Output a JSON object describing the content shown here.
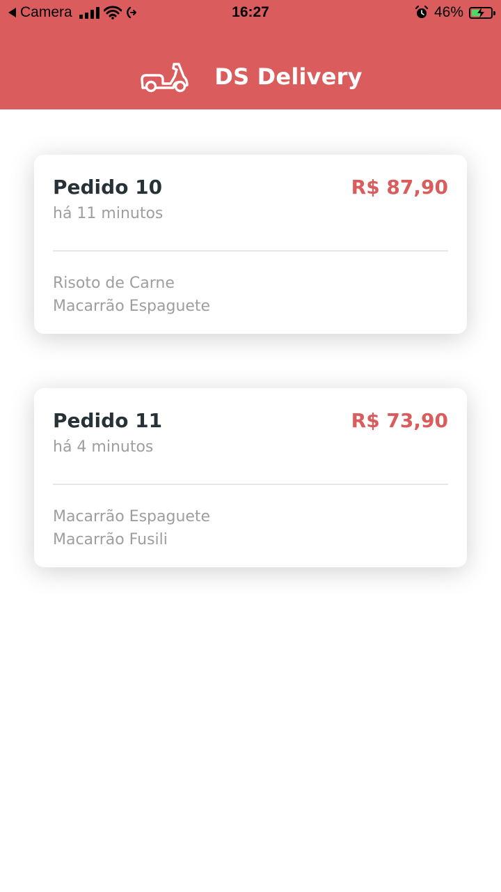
{
  "status_bar": {
    "back_label": "Camera",
    "time": "16:27",
    "battery_percent": "46%",
    "battery_level": 0.46,
    "icons": [
      "back-arrow-icon",
      "cellular-signal-icon",
      "wifi-icon",
      "call-forwarding-icon",
      "alarm-icon",
      "battery-charging-icon"
    ]
  },
  "header": {
    "title": "DS Delivery",
    "logo_icon": "delivery-scooter-icon",
    "background_color": "#DA5C5C"
  },
  "orders": [
    {
      "name": "Pedido 10",
      "time_ago": "há 11 minutos",
      "price": "R$ 87,90",
      "products": [
        "Risoto de Carne",
        "Macarrão Espaguete"
      ]
    },
    {
      "name": "Pedido 11",
      "time_ago": "há 4 minutos",
      "price": "R$ 73,90",
      "products": [
        "Macarrão Espaguete",
        "Macarrão Fusili"
      ]
    }
  ],
  "colors": {
    "accent": "#DA5C5C",
    "title_text": "#263238",
    "muted_text": "#9E9E9E"
  }
}
